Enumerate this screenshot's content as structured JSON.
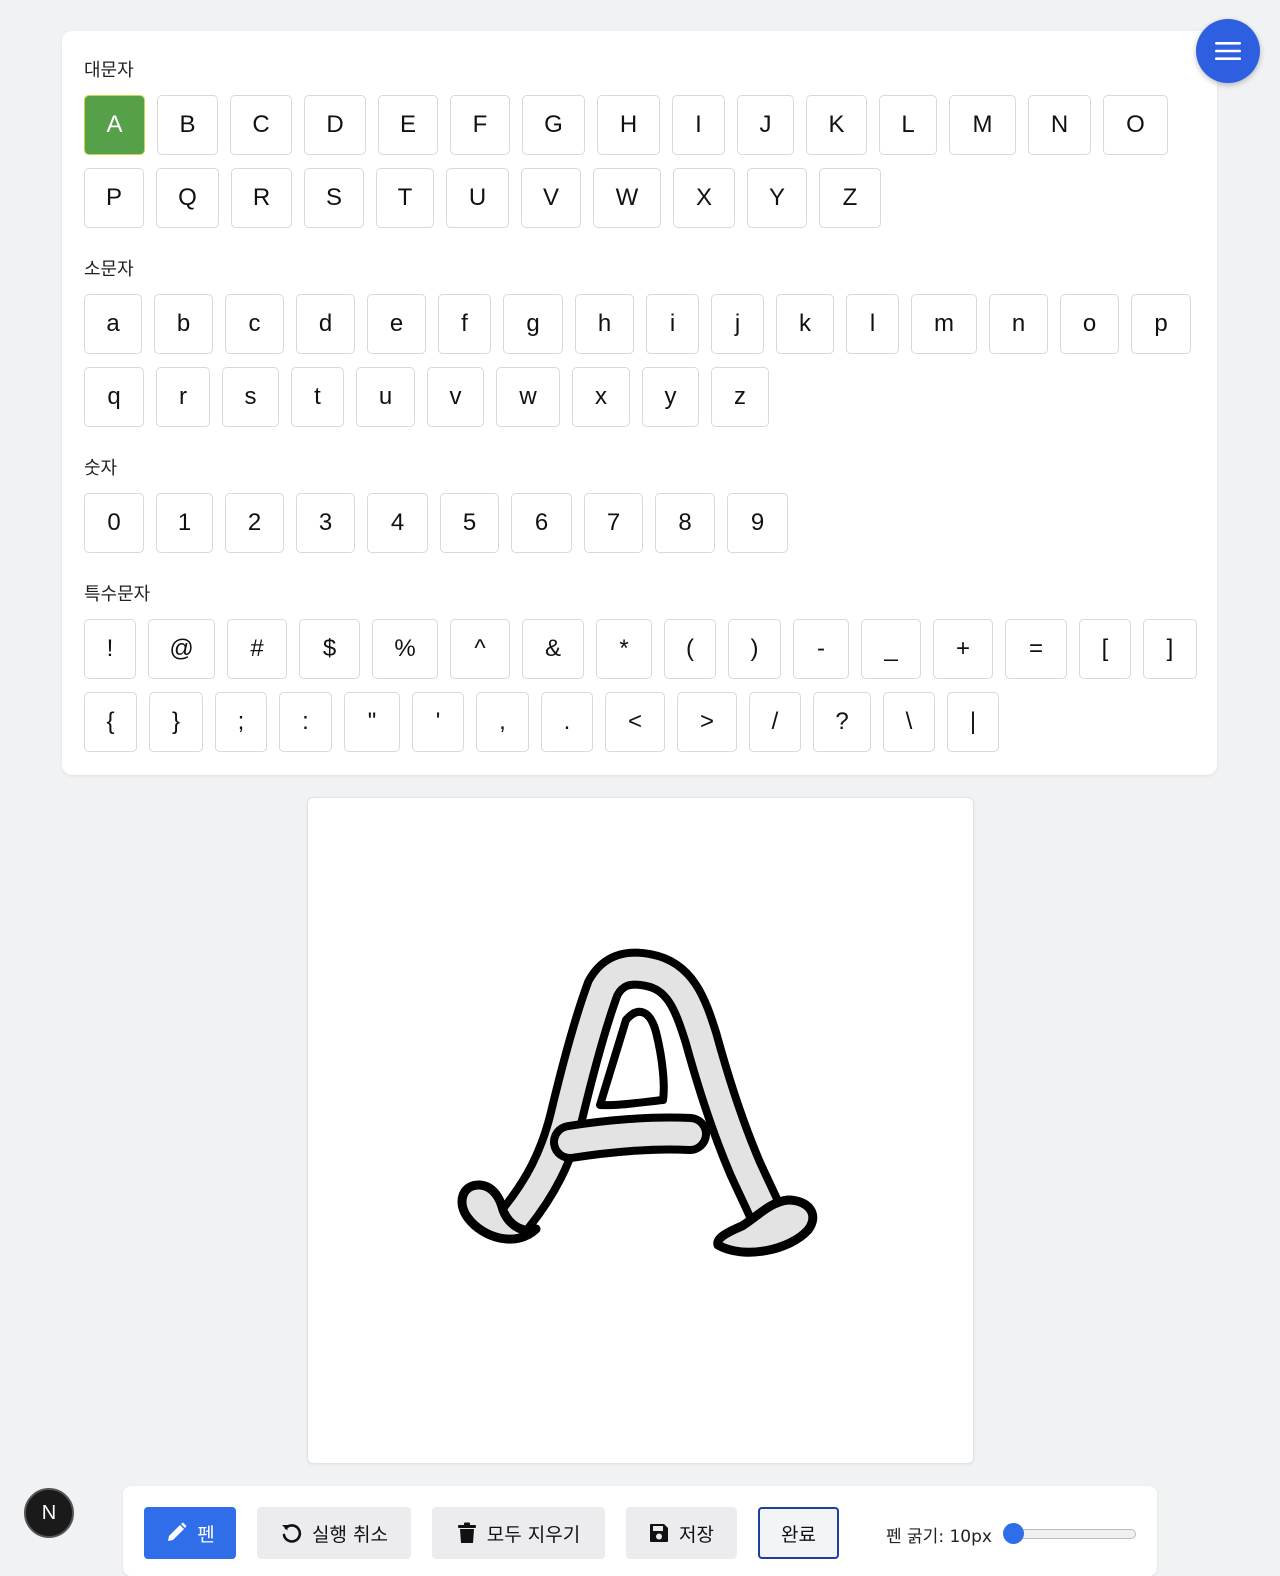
{
  "sections": {
    "upper": {
      "title": "대문자",
      "rows": [
        [
          "A",
          "B",
          "C",
          "D",
          "E",
          "F",
          "G",
          "H",
          "I",
          "J",
          "K",
          "L",
          "M",
          "N",
          "O"
        ],
        [
          "P",
          "Q",
          "R",
          "S",
          "T",
          "U",
          "V",
          "W",
          "X",
          "Y",
          "Z"
        ]
      ]
    },
    "lower": {
      "title": "소문자",
      "rows": [
        [
          "a",
          "b",
          "c",
          "d",
          "e",
          "f",
          "g",
          "h",
          "i",
          "j",
          "k",
          "l",
          "m",
          "n",
          "o",
          "p"
        ],
        [
          "q",
          "r",
          "s",
          "t",
          "u",
          "v",
          "w",
          "x",
          "y",
          "z"
        ]
      ]
    },
    "digits": {
      "title": "숫자",
      "rows": [
        [
          "0",
          "1",
          "2",
          "3",
          "4",
          "5",
          "6",
          "7",
          "8",
          "9"
        ]
      ]
    },
    "special": {
      "title": "특수문자",
      "rows": [
        [
          "!",
          "@",
          "#",
          "$",
          "%",
          "^",
          "&",
          "*",
          "(",
          ")",
          "-",
          "_",
          "+",
          "=",
          "[",
          "]"
        ],
        [
          "{",
          "}",
          ";",
          ":",
          "\"",
          "'",
          ",",
          ".",
          "<",
          ">",
          "/",
          "?",
          "\\",
          "|"
        ]
      ]
    }
  },
  "selected_char": "A",
  "menu_button": {
    "icon": "hamburger-menu-icon"
  },
  "canvas": {
    "drawn_glyph": "A"
  },
  "toolbar": {
    "pen": {
      "label": "펜",
      "icon": "pencil-icon"
    },
    "undo": {
      "label": "실행 취소",
      "icon": "undo-icon"
    },
    "clear_all": {
      "label": "모두 지우기",
      "icon": "trash-icon"
    },
    "save": {
      "label": "저장",
      "icon": "floppy-disk-icon"
    },
    "done": {
      "label": "완료"
    },
    "pen_thickness_label": "펜 굵기: 10px",
    "pen_thickness_value": 10
  },
  "dev_badge": {
    "label": "N"
  },
  "colors": {
    "accent_blue": "#2f6ee8",
    "selected_green": "#57a04a",
    "background": "#f1f2f4"
  }
}
